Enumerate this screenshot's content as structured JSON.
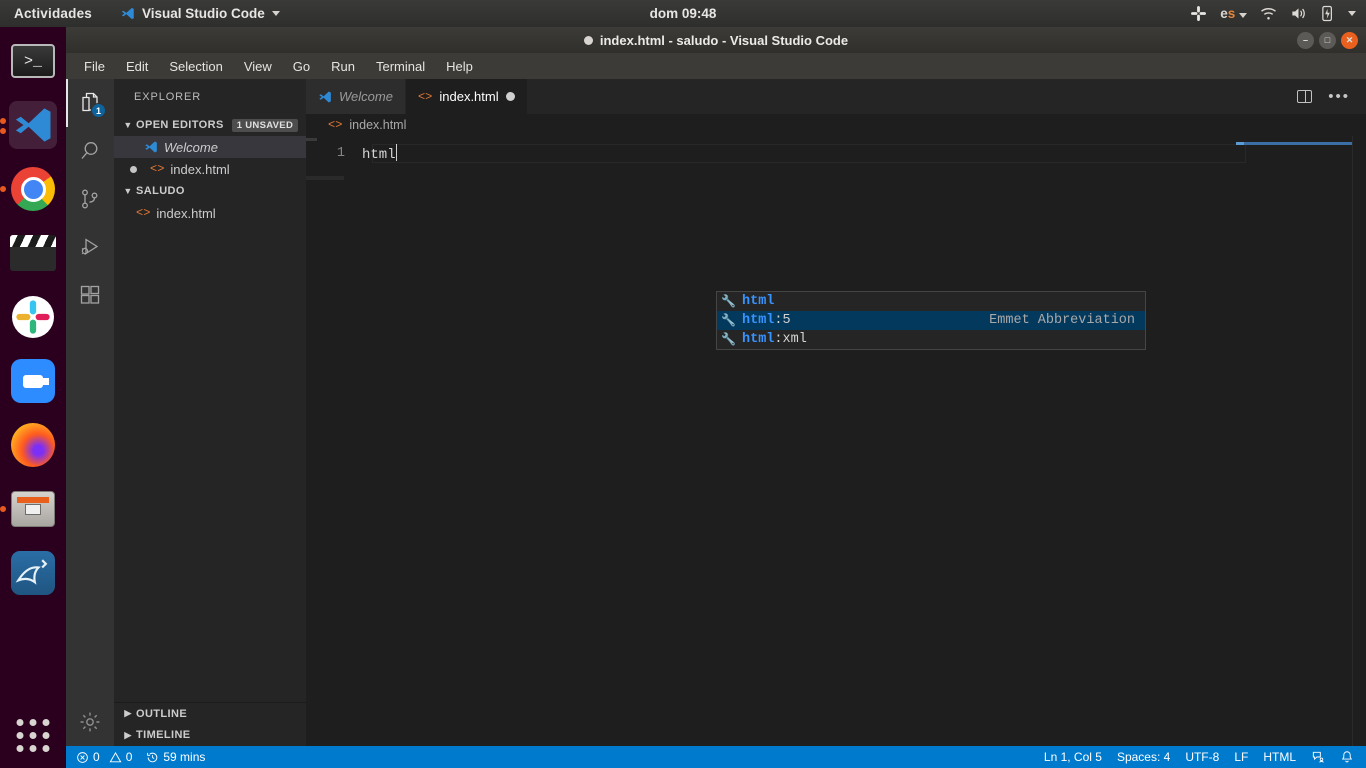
{
  "desktop": {
    "activities": "Actividades",
    "app_menu": "Visual Studio Code",
    "clock": "dom 09:48",
    "tray": {
      "slack_icon": "slack-icon",
      "language": "es",
      "wifi_icon": "wifi-icon",
      "volume_icon": "volume-icon",
      "battery_icon": "battery-charging-icon",
      "system_menu_icon": "chevron-down-icon"
    },
    "dock": [
      {
        "name": "terminal",
        "label": "Terminal",
        "running": false,
        "active": false
      },
      {
        "name": "visual-studio-code",
        "label": "Visual Studio Code",
        "running": true,
        "active": true
      },
      {
        "name": "google-chrome",
        "label": "Google Chrome",
        "running": true,
        "active": false
      },
      {
        "name": "video-editor",
        "label": "Video Editor",
        "running": false,
        "active": false
      },
      {
        "name": "slack",
        "label": "Slack",
        "running": false,
        "active": false
      },
      {
        "name": "zoom",
        "label": "Zoom",
        "running": false,
        "active": false
      },
      {
        "name": "firefox",
        "label": "Firefox",
        "running": false,
        "active": false
      },
      {
        "name": "files",
        "label": "Files",
        "running": true,
        "active": false
      },
      {
        "name": "mysql-workbench",
        "label": "MySQL Workbench",
        "running": false,
        "active": false
      }
    ],
    "show_applications": "Show Applications"
  },
  "window": {
    "title": "index.html - saludo - Visual Studio Code",
    "dirty": true,
    "controls": {
      "minimize": "–",
      "maximize": "□",
      "close": "✕"
    }
  },
  "menubar": [
    "File",
    "Edit",
    "Selection",
    "View",
    "Go",
    "Run",
    "Terminal",
    "Help"
  ],
  "activitybar": [
    {
      "name": "explorer",
      "label": "Explorer",
      "badge": "1",
      "active": true
    },
    {
      "name": "search",
      "label": "Search",
      "badge": "",
      "active": false
    },
    {
      "name": "source-control",
      "label": "Source Control",
      "badge": "",
      "active": false
    },
    {
      "name": "run-and-debug",
      "label": "Run and Debug",
      "badge": "",
      "active": false
    },
    {
      "name": "extensions",
      "label": "Extensions",
      "badge": "",
      "active": false
    },
    {
      "name": "manage",
      "label": "Manage",
      "badge": "",
      "active": false
    }
  ],
  "sidebar": {
    "title": "EXPLORER",
    "open_editors": {
      "label": "OPEN EDITORS",
      "badge": "1 UNSAVED",
      "items": [
        {
          "label": "Welcome",
          "icon": "vscode-icon",
          "italic": true,
          "modified": false,
          "selected": true
        },
        {
          "label": "index.html",
          "icon": "html-icon",
          "italic": false,
          "modified": true,
          "selected": false
        }
      ]
    },
    "folder": {
      "label": "SALUDO",
      "items": [
        {
          "label": "index.html",
          "icon": "html-icon"
        }
      ]
    },
    "bottom_sections": [
      {
        "label": "OUTLINE"
      },
      {
        "label": "TIMELINE"
      }
    ]
  },
  "editor": {
    "tabs": [
      {
        "label": "Welcome",
        "icon": "vscode-icon",
        "active": false,
        "dirty": false,
        "italic": true
      },
      {
        "label": "index.html",
        "icon": "html-icon",
        "active": true,
        "dirty": true,
        "italic": false
      }
    ],
    "actions": [
      {
        "name": "split-editor-right",
        "label": "Split Editor Right"
      },
      {
        "name": "more-actions",
        "label": "More Actions...",
        "glyph": "•••"
      }
    ],
    "breadcrumb": {
      "icon": "html-icon",
      "label": "index.html"
    },
    "line_number": "1",
    "code_text": "html"
  },
  "suggest_widget": {
    "items": [
      {
        "icon": "wrench-icon",
        "match": "html",
        "rest": "",
        "detail": "",
        "selected": false
      },
      {
        "icon": "wrench-icon",
        "match": "html",
        "rest": ":5",
        "detail": "Emmet Abbreviation",
        "selected": true
      },
      {
        "icon": "wrench-icon",
        "match": "html",
        "rest": ":xml",
        "detail": "",
        "selected": false
      }
    ]
  },
  "statusbar": {
    "errors": "0",
    "warnings": "0",
    "timer": "59 mins",
    "position": "Ln 1, Col 5",
    "indentation": "Spaces: 4",
    "encoding": "UTF-8",
    "eol": "LF",
    "language": "HTML",
    "feedback_icon": "feedback-icon",
    "bell_icon": "bell-icon",
    "background": "#007acc"
  }
}
